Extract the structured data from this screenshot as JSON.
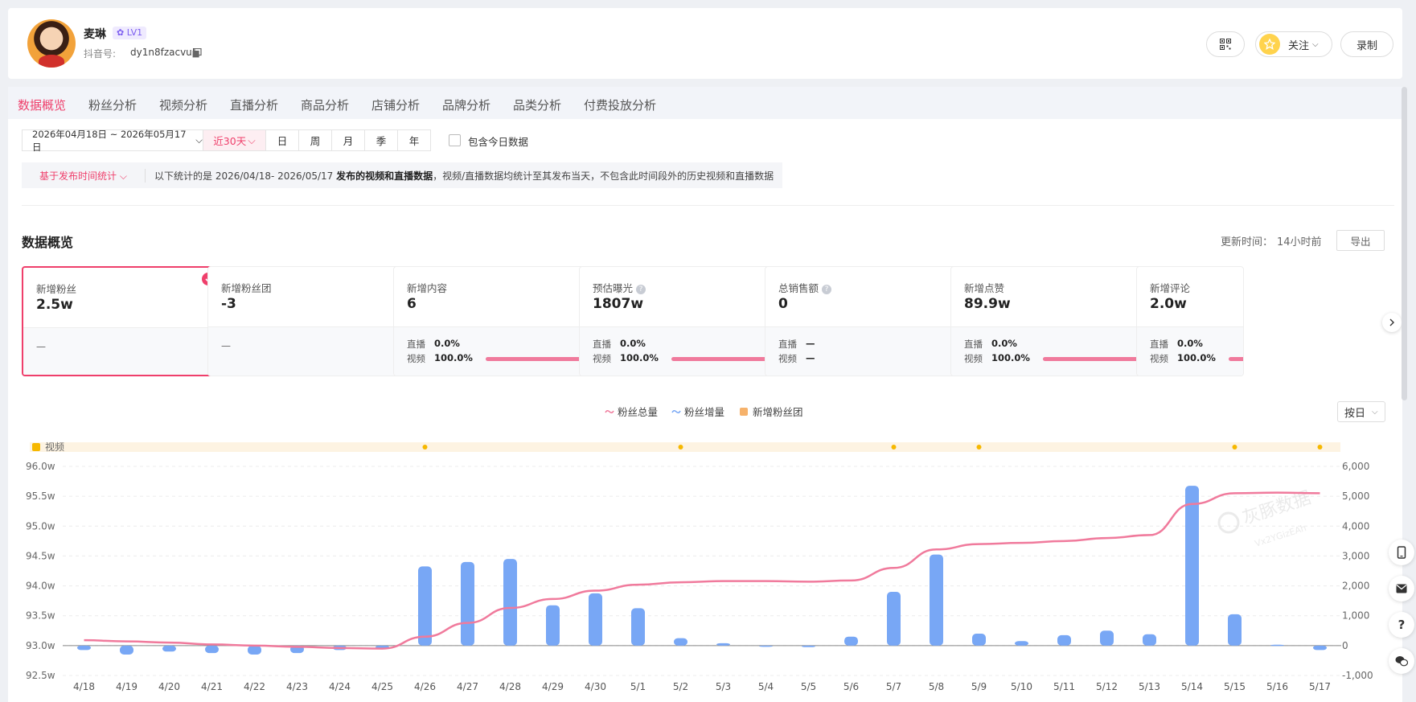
{
  "profile": {
    "name": "麦琳",
    "level": "LV1",
    "douyin_label": "抖音号:",
    "douyin_id": "dy1n8fzacvu5",
    "follow_label": "关注",
    "record_label": "录制"
  },
  "tabs": [
    "数据概览",
    "粉丝分析",
    "视频分析",
    "直播分析",
    "商品分析",
    "店铺分析",
    "品牌分析",
    "品类分析",
    "付费投放分析"
  ],
  "active_tab": 0,
  "filters": {
    "date_range": "2026年04月18日 ~ 2026年05月17日",
    "recent": "近30天",
    "periods": [
      "日",
      "周",
      "月",
      "季",
      "年"
    ],
    "include_today": "包含今日数据"
  },
  "notice": {
    "selector": "基于发布时间统计",
    "prefix": "以下统计的是 2026/04/18- 2026/05/17 ",
    "bold": "发布的视频和直播数据",
    "suffix": "，视频/直播数据均统计至其发布当天，不包含此时间段外的历史视频和直播数据"
  },
  "overview": {
    "title": "数据概览",
    "update_label": "更新时间：",
    "update_value": "14小时前",
    "export_label": "导出"
  },
  "cards": [
    {
      "label": "新增粉丝",
      "value": "2.5w",
      "dash": "—"
    },
    {
      "label": "新增粉丝团",
      "value": "-3",
      "dash": "—"
    },
    {
      "label": "新增内容",
      "value": "6",
      "live_label": "直播",
      "live_pct": "0.0%",
      "video_label": "视频",
      "video_pct": "100.0%",
      "video_share": 1.0
    },
    {
      "label": "预估曝光",
      "value": "1807w",
      "live_label": "直播",
      "live_pct": "0.0%",
      "video_label": "视频",
      "video_pct": "100.0%",
      "video_share": 1.0
    },
    {
      "label": "总销售额",
      "value": "0",
      "live_label": "直播",
      "live_pct": "—",
      "video_label": "视频",
      "video_pct": "—"
    },
    {
      "label": "新增点赞",
      "value": "89.9w",
      "live_label": "直播",
      "live_pct": "0.0%",
      "video_label": "视频",
      "video_pct": "100.0%",
      "video_share": 1.0
    },
    {
      "label": "新增评论",
      "value": "2.0w",
      "live_label": "直播",
      "live_pct": "0.0%",
      "video_label": "视频",
      "video_pct": "100.0%",
      "video_share": 1.0
    }
  ],
  "legend": {
    "total": "粉丝总量",
    "increase": "粉丝增量",
    "fan_group": "新增粉丝团",
    "by_day": "按日"
  },
  "video_track_label": "视频",
  "watermark": {
    "text": "灰豚数据",
    "sub": "Vx2YGizEAh"
  },
  "colors": {
    "accent": "#ef3f6b",
    "bar": "#78a7f5",
    "line": "#f07a9c",
    "video_dot": "#f6b800"
  },
  "chart_data": {
    "type": "bar",
    "categories": [
      "4/18",
      "4/19",
      "4/20",
      "4/21",
      "4/22",
      "4/23",
      "4/24",
      "4/25",
      "4/26",
      "4/27",
      "4/28",
      "4/29",
      "4/30",
      "5/1",
      "5/2",
      "5/3",
      "5/4",
      "5/5",
      "5/6",
      "5/7",
      "5/8",
      "5/9",
      "5/10",
      "5/11",
      "5/12",
      "5/13",
      "5/14",
      "5/15",
      "5/16",
      "5/17"
    ],
    "left_axis": {
      "ticks": [
        "92.5w",
        "93.0w",
        "93.5w",
        "94.0w",
        "94.5w",
        "95.0w",
        "95.5w",
        "96.0w"
      ],
      "ylim": [
        92.5,
        96.0
      ]
    },
    "right_axis": {
      "ticks": [
        "-1,000",
        "0",
        "1,000",
        "2,000",
        "3,000",
        "4,000",
        "5,000",
        "6,000"
      ],
      "ylim": [
        -1000,
        6000
      ]
    },
    "series": [
      {
        "name": "粉丝增量",
        "type": "bar",
        "axis": "right",
        "values": [
          -150,
          -300,
          -200,
          -250,
          -300,
          -250,
          -150,
          -100,
          2650,
          2800,
          2900,
          1350,
          1750,
          1250,
          250,
          80,
          0,
          -50,
          300,
          1800,
          3050,
          400,
          150,
          350,
          500,
          380,
          5350,
          1050,
          30,
          -150
        ]
      },
      {
        "name": "粉丝总量",
        "type": "line",
        "axis": "left",
        "values": [
          93.09,
          93.07,
          93.05,
          93.02,
          93.0,
          92.98,
          92.96,
          92.95,
          93.15,
          93.38,
          93.63,
          93.78,
          93.92,
          94.02,
          94.06,
          94.08,
          94.08,
          94.07,
          94.09,
          94.3,
          94.61,
          94.7,
          94.72,
          94.75,
          94.8,
          94.85,
          95.37,
          95.55,
          95.56,
          95.55
        ]
      }
    ],
    "video_days": [
      "4/26",
      "5/2",
      "5/7",
      "5/9",
      "5/15",
      "5/17"
    ]
  }
}
